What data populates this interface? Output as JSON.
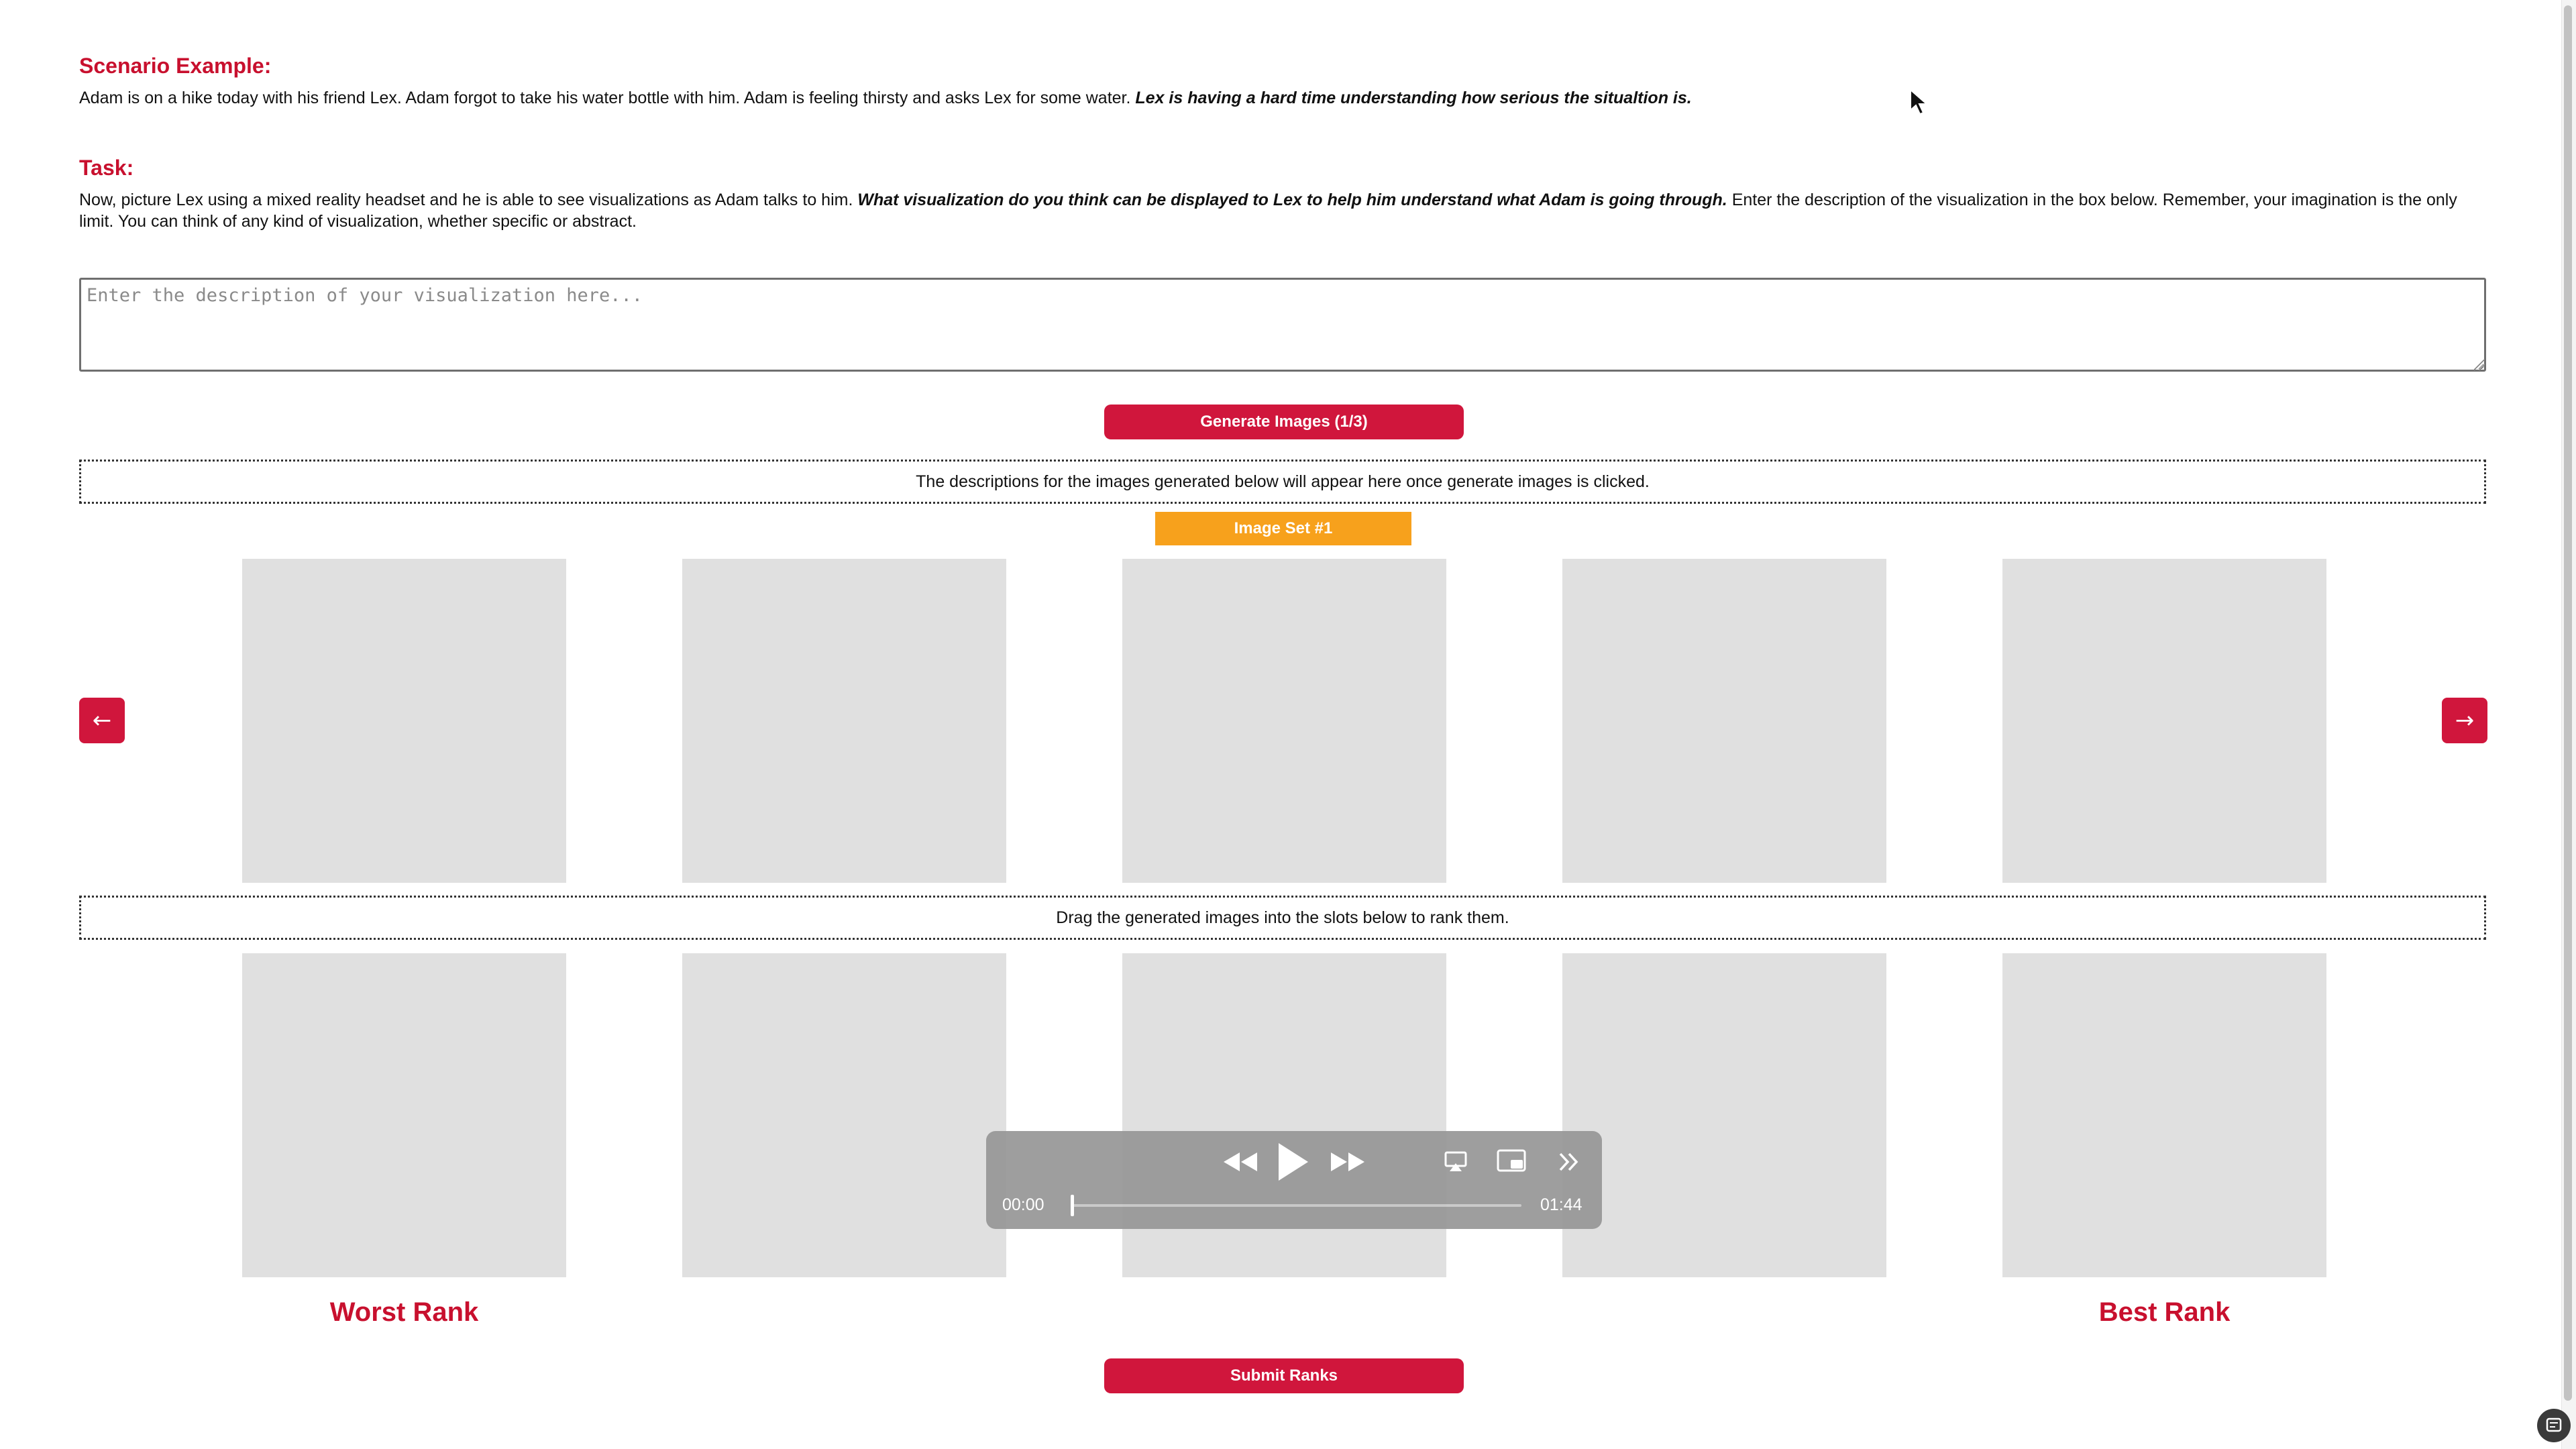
{
  "scenario": {
    "heading": "Scenario Example:",
    "text": "Adam is on a hike today with his friend Lex. Adam forgot to take his water bottle with him. Adam is feeling thirsty and asks Lex for some water.",
    "emphasis": "Lex is having a hard time understanding how serious the situaltion is."
  },
  "task": {
    "heading": "Task:",
    "text_before": "Now, picture Lex using a mixed reality headset and he is able to see visualizations as Adam talks to him.",
    "emphasis": "What visualization do you think can be displayed to Lex to help him understand what Adam is going through.",
    "text_after": "Enter the description of the visualization in the box below. Remember, your imagination is the only limit. You can think of any kind of visualization, whether specific or abstract."
  },
  "description_input": {
    "value": "",
    "placeholder": "Enter the description of your visualization here..."
  },
  "generate_button": {
    "label": "Generate Images (1/3)"
  },
  "descriptions_notice": "The descriptions for the images generated below will appear here once generate images is clicked.",
  "image_set": {
    "label": "Image Set #1"
  },
  "nav": {
    "prev": "←",
    "next": "→"
  },
  "generated_images": [
    "",
    "",
    "",
    "",
    ""
  ],
  "rank_instructions": "Drag the generated images into the slots below to rank them.",
  "rank_slots": [
    "",
    "",
    "",
    "",
    ""
  ],
  "rank_labels": {
    "worst": "Worst Rank",
    "best": "Best Rank"
  },
  "submit_button": {
    "label": "Submit Ranks"
  },
  "player": {
    "current_time": "00:00",
    "duration": "01:44",
    "progress": 0,
    "icons": [
      "rewind-icon",
      "play-icon",
      "fast-forward-icon",
      "airplay-icon",
      "picture-in-picture-icon",
      "more-icon"
    ]
  },
  "colors": {
    "accent_red": "#d0163c",
    "heading_red": "#c8102e",
    "image_set_orange": "#f7a11c",
    "slot_gray": "#e0e0e0"
  }
}
